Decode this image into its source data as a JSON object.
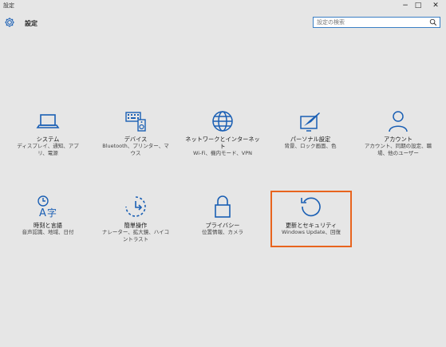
{
  "window": {
    "title": "設定",
    "controls": {
      "minimize": "−",
      "maximize": "□",
      "close": "✕"
    }
  },
  "header": {
    "title": "設定",
    "search_placeholder": "設定の検索"
  },
  "accent_color": "#1a5fb4",
  "selection_color": "#e8641e",
  "tiles": [
    {
      "label": "システム",
      "desc": "ディスプレイ、通知、アプリ、電源",
      "icon": "laptop-icon"
    },
    {
      "label": "デバイス",
      "desc": "Bluetooth、プリンター、マウス",
      "icon": "devices-icon"
    },
    {
      "label": "ネットワークとインターネット",
      "desc": "Wi-Fi、機内モード、VPN",
      "icon": "globe-icon"
    },
    {
      "label": "パーソナル設定",
      "desc": "背景、ロック画面、色",
      "icon": "personalization-icon"
    },
    {
      "label": "アカウント",
      "desc": "アカウント、同期の設定、職場、他のユーザー",
      "icon": "person-icon"
    },
    {
      "label": "時刻と言語",
      "desc": "音声認識、地域、日付",
      "icon": "time-language-icon"
    },
    {
      "label": "簡単操作",
      "desc": "ナレーター、拡大鏡、ハイコントラスト",
      "icon": "ease-of-access-icon"
    },
    {
      "label": "プライバシー",
      "desc": "位置情報、カメラ",
      "icon": "lock-icon"
    },
    {
      "label": "更新とセキュリティ",
      "desc": "Windows Update、回復",
      "icon": "update-icon",
      "selected": true
    }
  ]
}
